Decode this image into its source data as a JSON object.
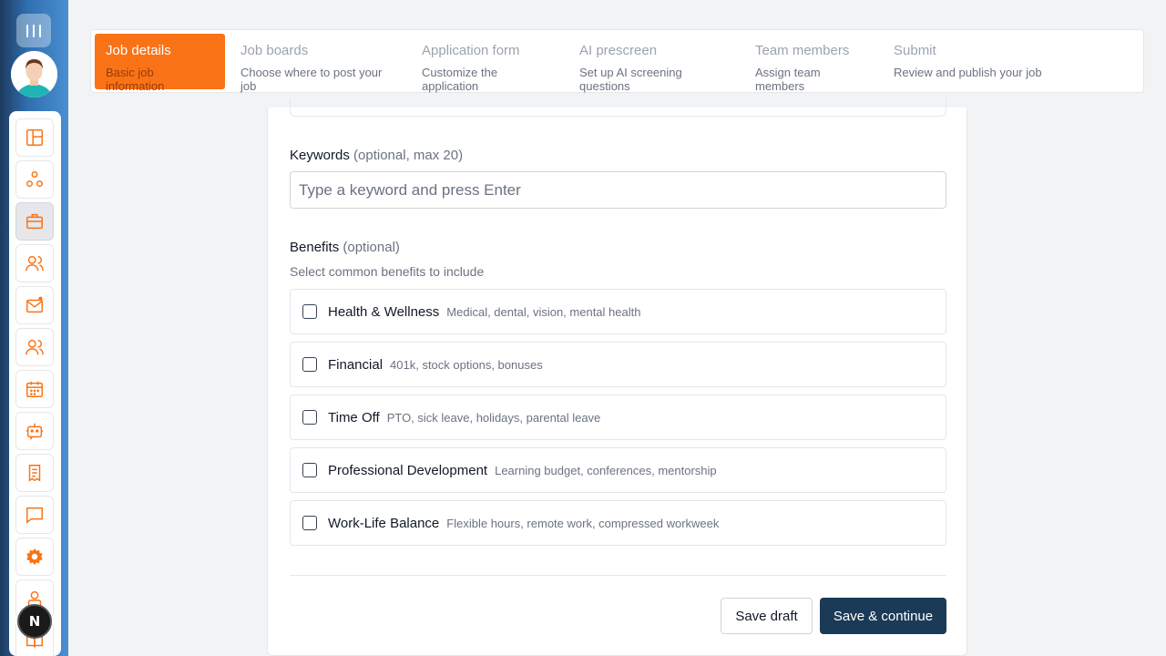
{
  "stepper": {
    "steps": [
      {
        "title": "Job details",
        "subtitle": "Basic job information",
        "active": true
      },
      {
        "title": "Job boards",
        "subtitle": "Choose where to post your job"
      },
      {
        "title": "Application form",
        "subtitle": "Customize the application"
      },
      {
        "title": "AI prescreen",
        "subtitle": "Set up AI screening questions"
      },
      {
        "title": "Team members",
        "subtitle": "Assign team members"
      },
      {
        "title": "Submit",
        "subtitle": "Review and publish your job"
      }
    ]
  },
  "sidebar": {
    "icons": [
      "dashboard-icon",
      "org-chart-icon",
      "briefcase-icon",
      "people-icon",
      "mail-notification-icon",
      "people-icon",
      "calendar-icon",
      "robot-icon",
      "receipt-icon",
      "chat-icon",
      "gear-icon",
      "person-icon",
      "book-icon"
    ],
    "active_icon": "briefcase-icon",
    "badge": "N"
  },
  "form": {
    "keywords": {
      "label": "Keywords",
      "hint": "(optional, max 20)",
      "placeholder": "Type a keyword and press Enter"
    },
    "benefits": {
      "label": "Benefits",
      "hint": "(optional)",
      "helper": "Select common benefits to include",
      "items": [
        {
          "title": "Health & Wellness",
          "desc": "Medical, dental, vision, mental health",
          "checked": false
        },
        {
          "title": "Financial",
          "desc": "401k, stock options, bonuses",
          "checked": false
        },
        {
          "title": "Time Off",
          "desc": "PTO, sick leave, holidays, parental leave",
          "checked": false
        },
        {
          "title": "Professional Development",
          "desc": "Learning budget, conferences, mentorship",
          "checked": false
        },
        {
          "title": "Work-Life Balance",
          "desc": "Flexible hours, remote work, compressed workweek",
          "checked": false
        }
      ]
    }
  },
  "actions": {
    "save_draft": "Save draft",
    "save_continue": "Save & continue"
  },
  "colors": {
    "accent": "#f97316",
    "primary_button": "#1b3a57"
  }
}
